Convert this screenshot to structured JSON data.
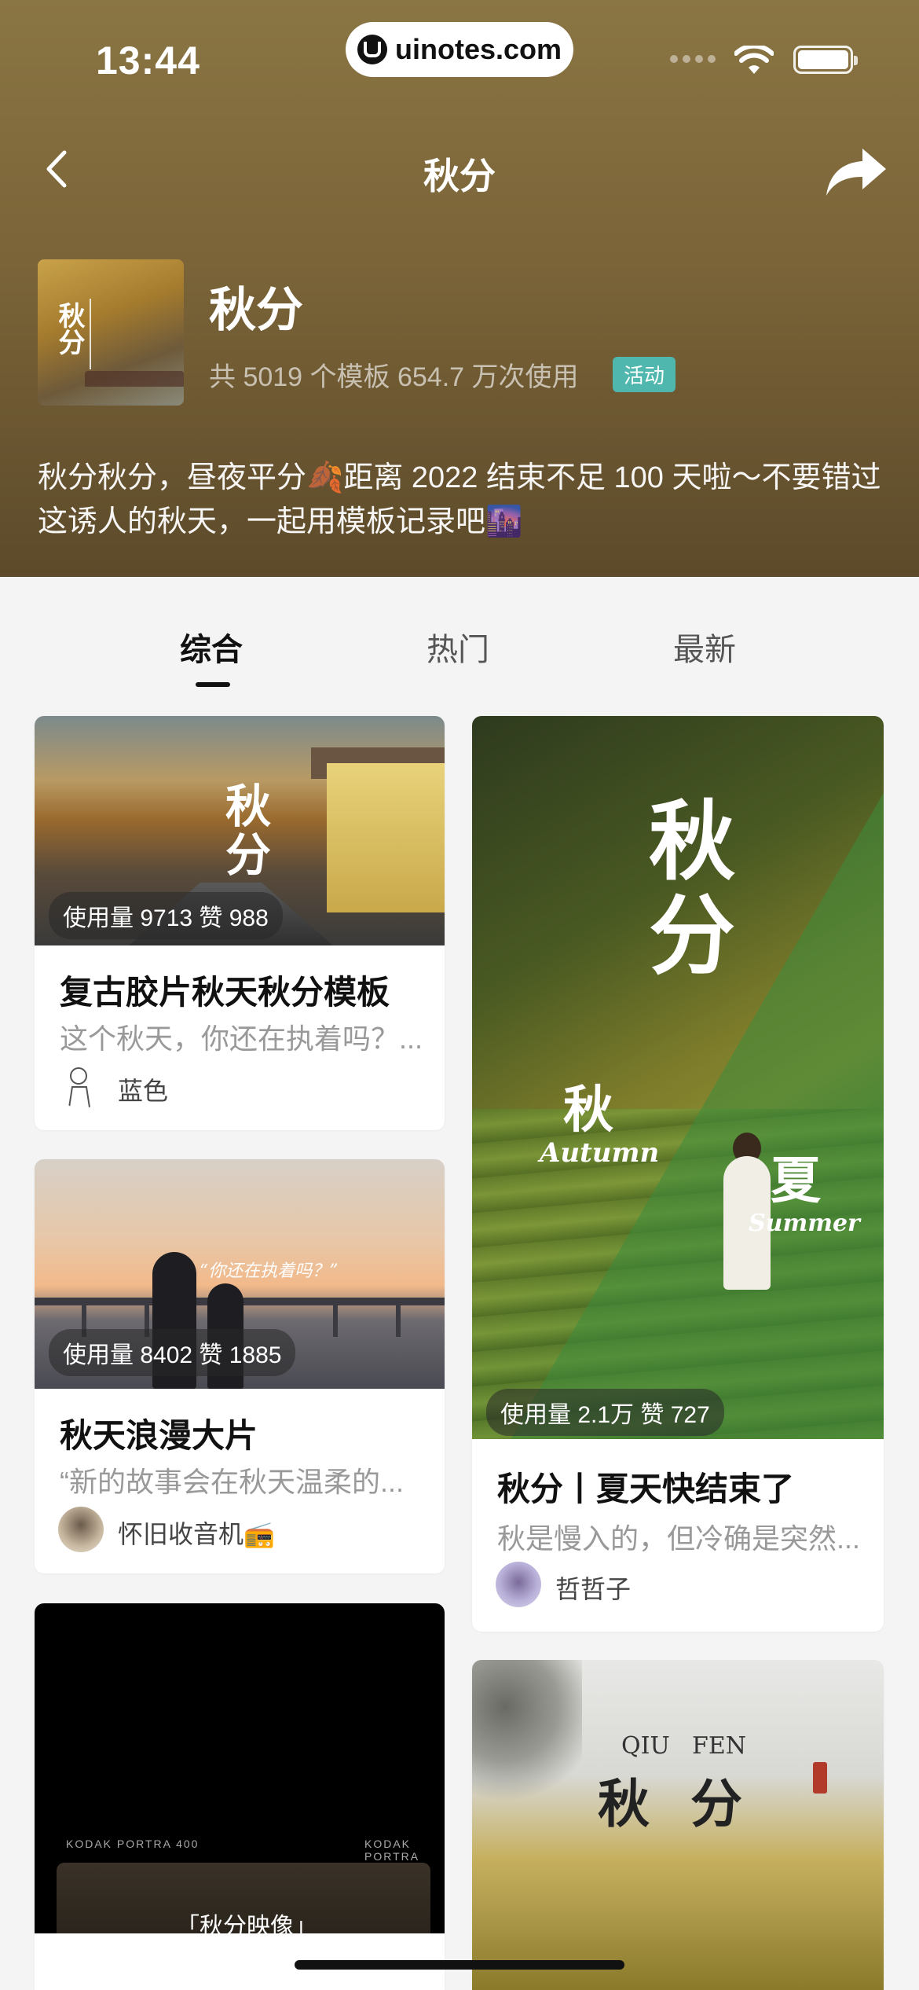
{
  "status_bar": {
    "time": "13:44",
    "url": "uinotes.com"
  },
  "nav": {
    "title": "秋分"
  },
  "topic": {
    "cover_title": "秋分",
    "name": "秋分",
    "stats": "共 5019 个模板 654.7 万次使用",
    "badge": "活动",
    "description": "秋分秋分，昼夜平分🍂距离 2022 结束不足 100 天啦～不要错过这诱人的秋天，一起用模板记录吧🌆"
  },
  "tabs": [
    {
      "label": "综合",
      "active": true
    },
    {
      "label": "热门",
      "active": false
    },
    {
      "label": "最新",
      "active": false
    }
  ],
  "cards": [
    {
      "overlay": "秋分",
      "stats": "使用量 9713  赞 988",
      "title": "复古胶片秋天秋分模板",
      "desc": "这个秋天，你还在执着吗？...",
      "author": "蓝色"
    },
    {
      "overlay": "“你还在执着吗？”",
      "stats": "使用量 8402  赞 1885",
      "title": "秋天浪漫大片",
      "desc": "“新的故事会在秋天温柔的...",
      "author": "怀旧收音机📻"
    },
    {
      "overlay_main": "秋分",
      "overlay_left_cn": "秋",
      "overlay_left_en": "Autumn",
      "overlay_right_cn": "夏",
      "overlay_right_en": "Summer",
      "stats": "使用量 2.1万  赞 727",
      "title": "秋分丨夏天快结束了",
      "desc": "秋是慢入的，但冷确是突然...",
      "author": "哲哲子"
    },
    {
      "kodak": "KODAK PORTRA 400",
      "overlay": "「秋分映像」"
    },
    {
      "en_left": "QIU",
      "en_right": "FEN",
      "cn_left": "秋",
      "cn_right": "分"
    }
  ],
  "colors": {
    "hero_top": "#8a7544",
    "hero_bottom": "#5c4a2a",
    "badge": "#4fb7ad",
    "background": "#f4f4f4"
  }
}
